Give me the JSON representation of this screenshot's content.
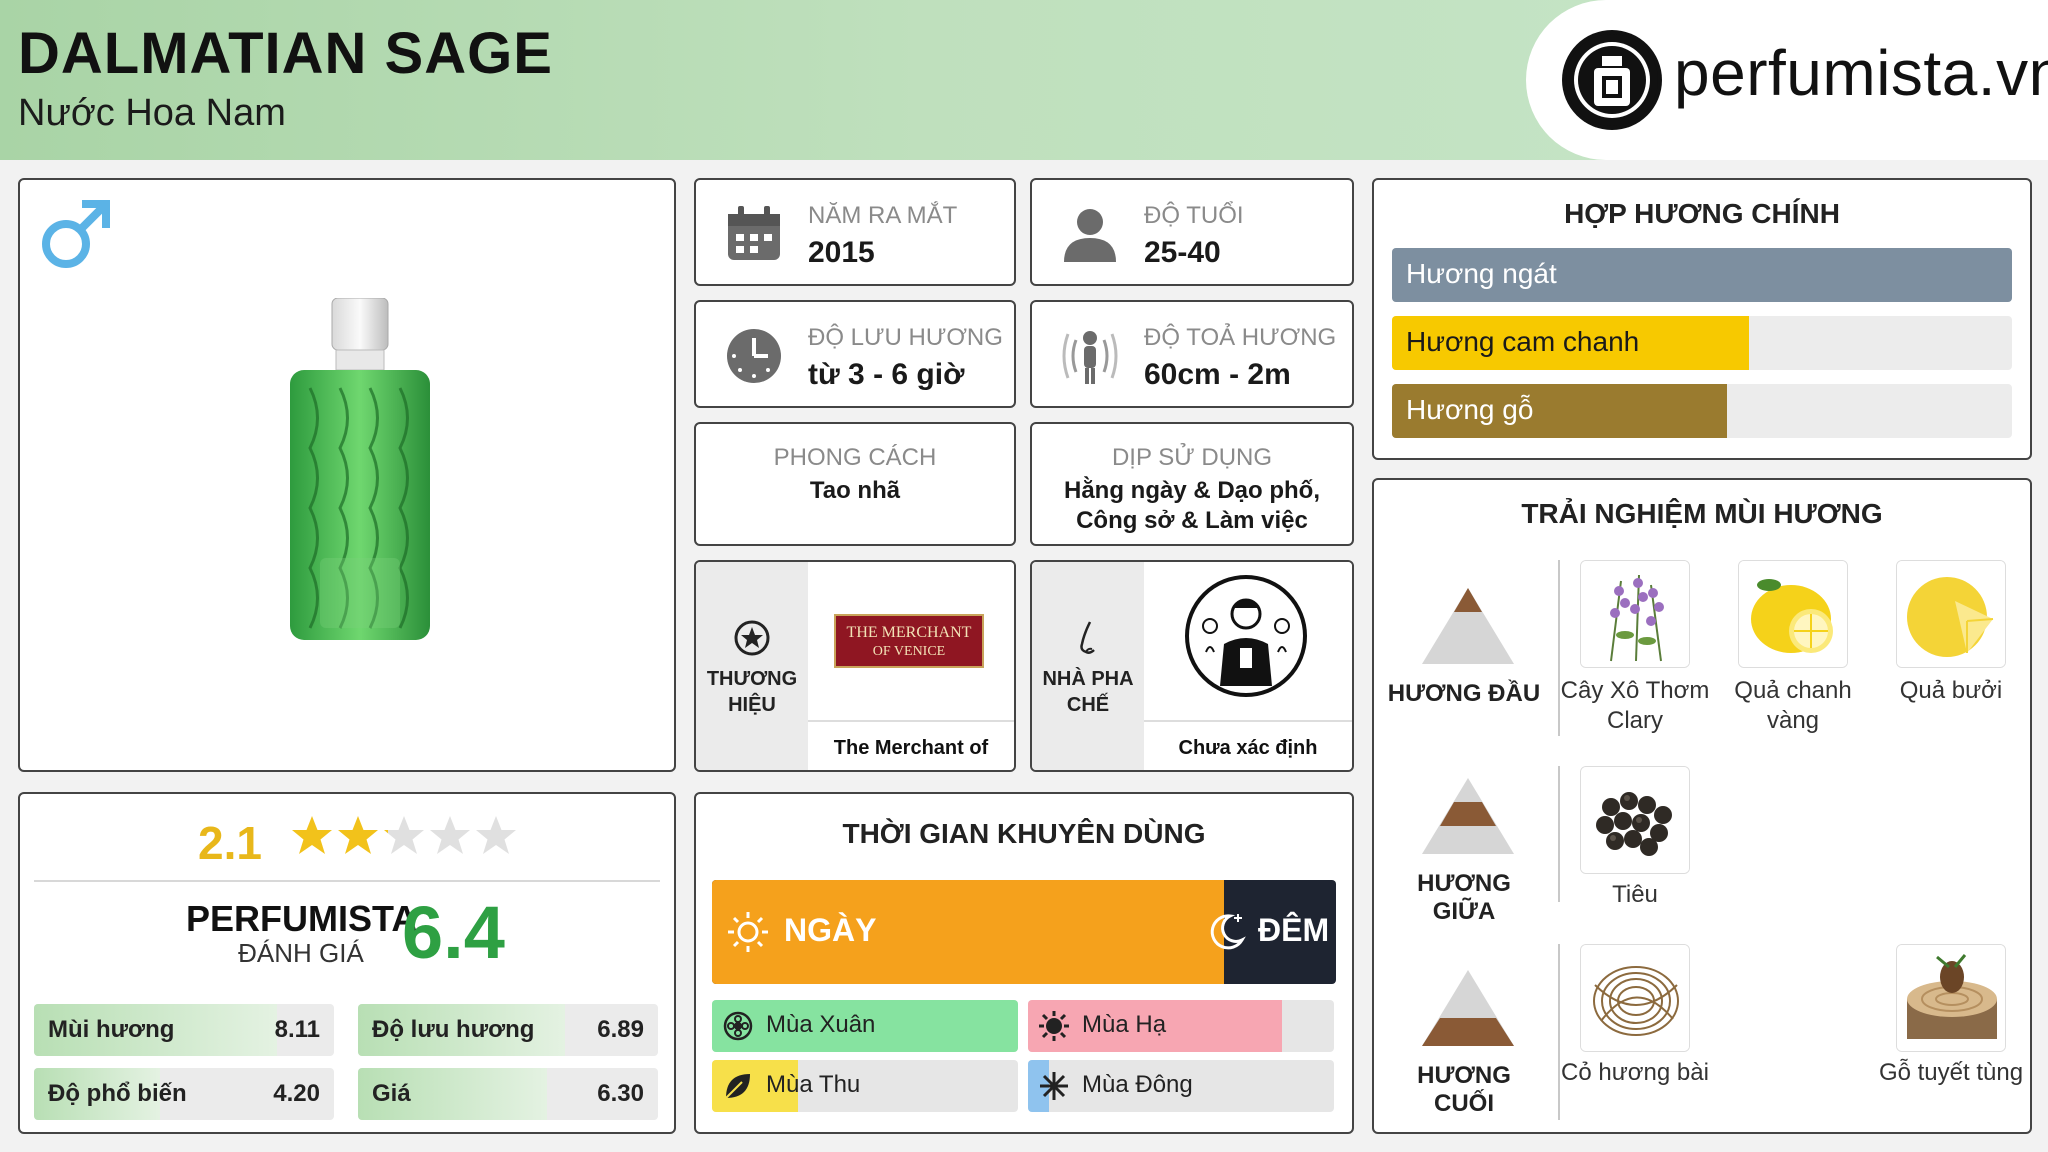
{
  "header": {
    "title": "DALMATIAN SAGE",
    "subtitle": "Nước Hoa Nam",
    "logo_text": "perfumista.vn"
  },
  "info": {
    "launch_label": "NĂM RA MẮT",
    "launch_value": "2015",
    "age_label": "ĐỘ TUỔI",
    "age_value": "25-40",
    "longevity_label": "ĐỘ LƯU HƯƠNG",
    "longevity_value": "từ 3 - 6 giờ",
    "sillage_label": "ĐỘ TOẢ HƯƠNG",
    "sillage_value": "60cm - 2m",
    "style_label": "PHONG CÁCH",
    "style_value": "Tao nhã",
    "occasion_label": "DỊP SỬ DỤNG",
    "occasion_value": "Hằng ngày & Dạo phố, Công sở & Làm việc"
  },
  "brand": {
    "label": "THƯƠNG HIỆU",
    "logo_line1": "THE MERCHANT",
    "logo_line2": "OF VENICE",
    "name": "The Merchant of Venice"
  },
  "perfumer": {
    "label": "NHÀ PHA CHẾ",
    "name": "Chưa xác định"
  },
  "accords": {
    "title": "HỢP HƯƠNG CHÍNH",
    "items": [
      {
        "label": "Hương ngát",
        "value": 1.0,
        "color": "#7d8fa0",
        "text_color": "#ffffff"
      },
      {
        "label": "Hương cam chanh",
        "value": 0.575,
        "color": "#f7c900",
        "text_color": "#1a1a1a"
      },
      {
        "label": "Hương gỗ",
        "value": 0.54,
        "color": "#9a7b2f",
        "text_color": "#ffffff"
      }
    ]
  },
  "notes": {
    "title": "TRẢI NGHIỆM MÙI HƯƠNG",
    "top_label": "HƯƠNG ĐẦU",
    "middle_label": "HƯƠNG GIỮA",
    "base_label": "HƯƠNG CUỐI",
    "top": [
      "Cây Xô Thơm Clary",
      "Quả chanh vàng",
      "Quả bưởi"
    ],
    "middle": [
      "Tiêu"
    ],
    "base": [
      "Cỏ hương bài",
      "Gỗ tuyết tùng"
    ]
  },
  "ratings": {
    "user_score": "2.1",
    "stars": 2.1,
    "perfumista_label": "PERFUMISTA",
    "rating_label": "ĐÁNH GIÁ",
    "perfumista_score": "6.4",
    "metrics": [
      {
        "label": "Mùi hương",
        "value": "8.11",
        "fraction": 0.811
      },
      {
        "label": "Độ lưu hương",
        "value": "6.89",
        "fraction": 0.689
      },
      {
        "label": "Độ phổ biến",
        "value": "4.20",
        "fraction": 0.42
      },
      {
        "label": "Giá",
        "value": "6.30",
        "fraction": 0.63
      }
    ]
  },
  "time": {
    "title": "THỜI GIAN KHUYÊN DÙNG",
    "day_label": "NGÀY",
    "night_label": "ĐÊM",
    "day_fraction": 0.82,
    "seasons": [
      {
        "label": "Mùa Xuân",
        "fraction": 1.0,
        "color": "#86e3a0"
      },
      {
        "label": "Mùa Hạ",
        "fraction": 0.83,
        "color": "#f7a6b2"
      },
      {
        "label": "Mùa Thu",
        "fraction": 0.28,
        "color": "#f7e04a"
      },
      {
        "label": "Mùa Đông",
        "fraction": 0.07,
        "color": "#8fc3ee"
      }
    ]
  },
  "colors": {
    "gender": "#5bb3e6",
    "score_green": "#2ea043",
    "star_gold": "#f2c21b",
    "user_score": "#e8b71a",
    "day": "#f5a11c",
    "night": "#1e2431"
  }
}
